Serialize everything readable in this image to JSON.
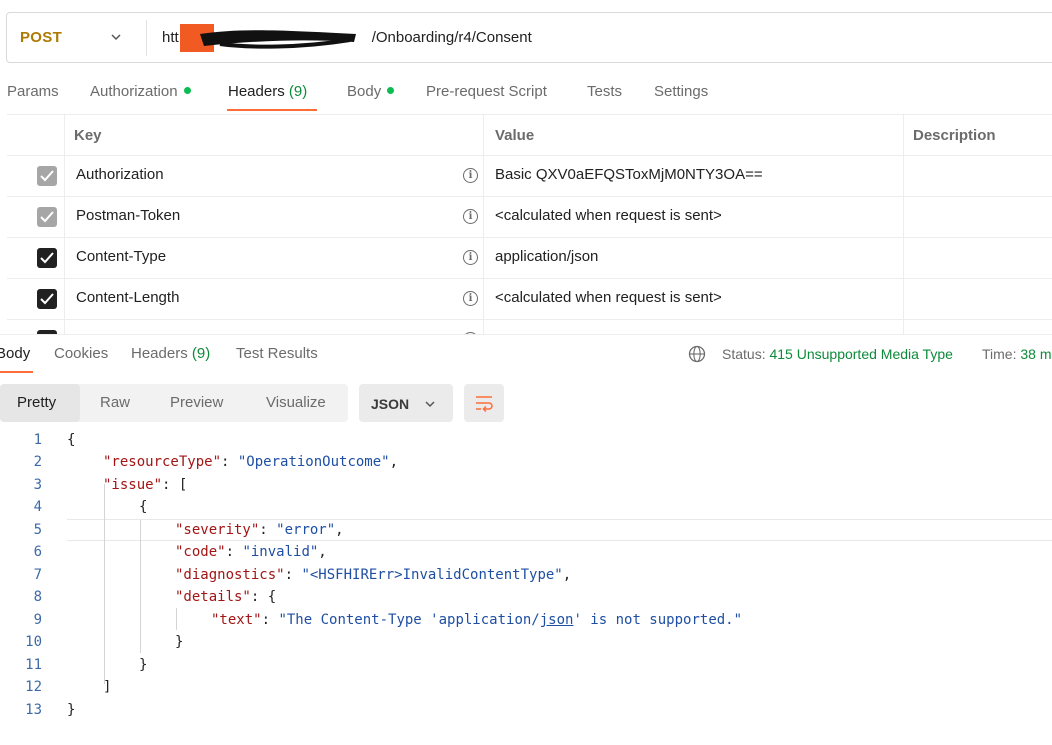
{
  "request": {
    "method": "POST",
    "url_visible": "/Onboarding/r4/Consent",
    "url_prefix": "htt"
  },
  "request_tabs": [
    {
      "label": "Params"
    },
    {
      "label": "Authorization"
    },
    {
      "label": "Headers",
      "count": "(9)"
    },
    {
      "label": "Body"
    },
    {
      "label": "Pre-request Script"
    },
    {
      "label": "Tests"
    },
    {
      "label": "Settings"
    }
  ],
  "headers_table": {
    "columns": [
      "Key",
      "Value",
      "Description"
    ],
    "rows": [
      {
        "key": "Authorization",
        "value": "Basic QXV0aEFQSToxMjM0NTY3OA=="
      },
      {
        "key": "Postman-Token",
        "value": "<calculated when request is sent>"
      },
      {
        "key": "Content-Type",
        "value": "application/json"
      },
      {
        "key": "Content-Length",
        "value": "<calculated when request is sent>"
      }
    ],
    "info_icon": "i"
  },
  "response_tabs": [
    {
      "label": "Body"
    },
    {
      "label": "Cookies"
    },
    {
      "label": "Headers",
      "count": "(9)"
    },
    {
      "label": "Test Results"
    }
  ],
  "status": {
    "label": "Status:",
    "value": "415 Unsupported Media Type",
    "time_label": "Time:",
    "time_value": "38 m"
  },
  "view_modes": [
    "Pretty",
    "Raw",
    "Preview",
    "Visualize"
  ],
  "format": "JSON",
  "code": {
    "line_numbers": [
      "1",
      "2",
      "3",
      "4",
      "5",
      "6",
      "7",
      "8",
      "9",
      "10",
      "11",
      "12",
      "13"
    ],
    "brace_open": "{",
    "brace_close": "}",
    "bracket_open": "[",
    "bracket_close": "]",
    "colon": ": ",
    "comma": ",",
    "k_resourceType": "\"resourceType\"",
    "v_resourceType": "\"OperationOutcome\"",
    "k_issue": "\"issue\"",
    "k_severity": "\"severity\"",
    "v_severity": "\"error\"",
    "k_code": "\"code\"",
    "v_code": "\"invalid\"",
    "k_diagnostics": "\"diagnostics\"",
    "v_diagnostics": "\"<HSFHIRErr>InvalidContentType\"",
    "k_details": "\"details\"",
    "k_text": "\"text\"",
    "v_text_a": "\"The Content-Type 'application/",
    "v_text_b": "json",
    "v_text_c": "' is not supported.\""
  }
}
